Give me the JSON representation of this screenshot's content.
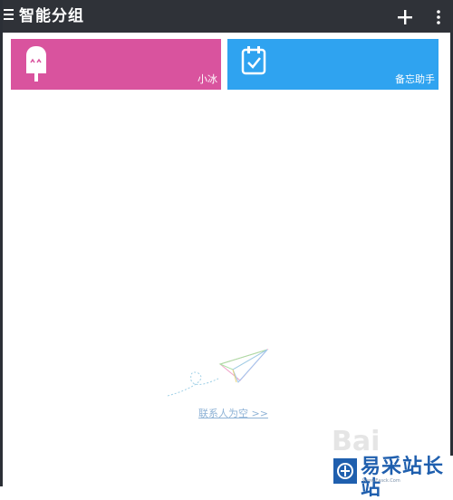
{
  "header": {
    "title": "智能分组"
  },
  "cards": [
    {
      "label": "小冰",
      "color": "#d9539e",
      "icon": "popsicle-icon"
    },
    {
      "label": "备忘助手",
      "color": "#2fa3f0",
      "icon": "calendar-check-icon"
    }
  ],
  "empty_state": {
    "text": "联系人为空 >>",
    "icon": "paper-plane-icon"
  },
  "watermark": {
    "site": "易采站长站",
    "url": "Www.Easck.Com",
    "baidu": "Bai"
  },
  "colors": {
    "header_bg": "#2f3238",
    "card_pink": "#d9539e",
    "card_blue": "#2fa3f0",
    "link": "#8fb3d6"
  }
}
